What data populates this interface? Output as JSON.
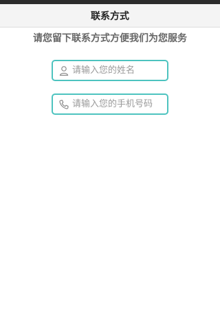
{
  "header": {
    "title": "联系方式"
  },
  "subtitle": "请您留下联系方式方便我们为您服务",
  "form": {
    "name_placeholder": "请输入您的姓名",
    "phone_placeholder": "请输入您的手机号码"
  },
  "icons": {
    "name": "user-icon",
    "phone": "phone-icon"
  },
  "colors": {
    "accent": "#4dc3bf",
    "header_bg": "#f4f4f4",
    "status_bar": "#2b2b2b"
  }
}
